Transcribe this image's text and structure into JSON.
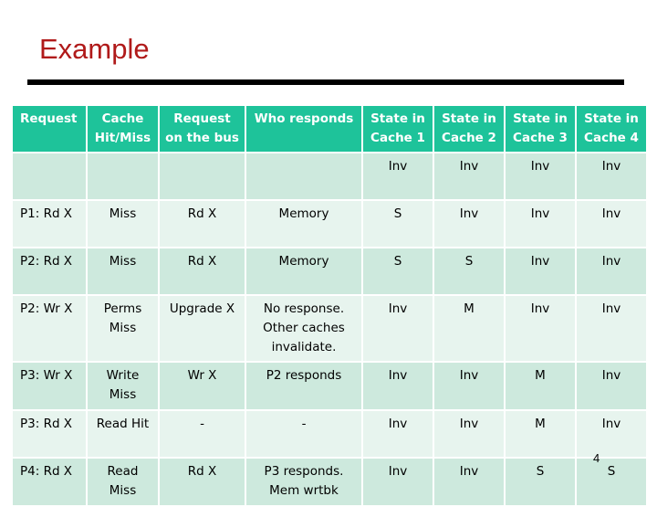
{
  "title": "Example",
  "table": {
    "headers": [
      "Request",
      "Cache Hit/Miss",
      "Request on the bus",
      "Who responds",
      "State in Cache 1",
      "State in Cache 2",
      "State in Cache 3",
      "State in Cache 4"
    ],
    "header_lines": [
      [
        "Request",
        ""
      ],
      [
        "Cache",
        "Hit/Miss"
      ],
      [
        "Request",
        "on the bus"
      ],
      [
        "Who responds",
        ""
      ],
      [
        "State in",
        "Cache 1"
      ],
      [
        "State in",
        "Cache 2"
      ],
      [
        "State in",
        "Cache 3"
      ],
      [
        "State in",
        "Cache 4"
      ]
    ],
    "rows": [
      {
        "request": "",
        "hit_miss": [
          "",
          ""
        ],
        "bus": "",
        "responds": [
          "",
          "",
          ""
        ],
        "c1": "Inv",
        "c2": "Inv",
        "c3": "Inv",
        "c4": "Inv"
      },
      {
        "request": "P1: Rd X",
        "hit_miss": [
          "Miss",
          ""
        ],
        "bus": "Rd X",
        "responds": [
          "Memory",
          "",
          ""
        ],
        "c1": "S",
        "c2": "Inv",
        "c3": "Inv",
        "c4": "Inv"
      },
      {
        "request": "P2: Rd X",
        "hit_miss": [
          "Miss",
          ""
        ],
        "bus": "Rd X",
        "responds": [
          "Memory",
          "",
          ""
        ],
        "c1": "S",
        "c2": "S",
        "c3": "Inv",
        "c4": "Inv"
      },
      {
        "request": "P2: Wr X",
        "hit_miss": [
          "Perms",
          "Miss"
        ],
        "bus": "Upgrade X",
        "responds": [
          "No response.",
          "Other caches",
          "invalidate."
        ],
        "c1": "Inv",
        "c2": "M",
        "c3": "Inv",
        "c4": "Inv"
      },
      {
        "request": "P3: Wr X",
        "hit_miss": [
          "Write",
          "Miss"
        ],
        "bus": "Wr X",
        "responds": [
          "P2 responds",
          "",
          ""
        ],
        "c1": "Inv",
        "c2": "Inv",
        "c3": "M",
        "c4": "Inv"
      },
      {
        "request": "P3: Rd X",
        "hit_miss": [
          "Read Hit",
          ""
        ],
        "bus": "-",
        "responds": [
          "-",
          "",
          ""
        ],
        "c1": "Inv",
        "c2": "Inv",
        "c3": "M",
        "c4": "Inv"
      },
      {
        "request": "P4: Rd X",
        "hit_miss": [
          "Read",
          "Miss"
        ],
        "bus": "Rd X",
        "responds": [
          "P3 responds.",
          "Mem wrtbk",
          ""
        ],
        "c1": "Inv",
        "c2": "Inv",
        "c3": "S",
        "c4": "S"
      }
    ]
  },
  "colors": {
    "title": "#b01a1a",
    "header_bg": "#1ec39a",
    "row_dark": "#cde9dd",
    "row_light": "#e7f4ee"
  },
  "page_number": "4"
}
